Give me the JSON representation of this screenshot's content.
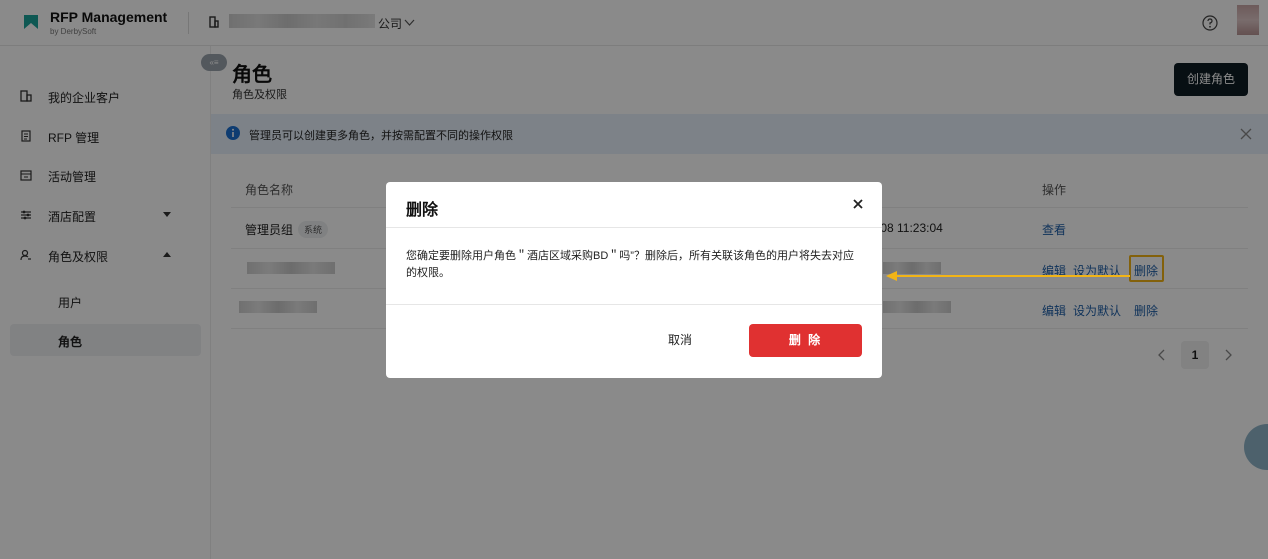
{
  "app": {
    "title": "RFP Management",
    "subtitle": "by DerbySoft"
  },
  "header": {
    "company_suffix": "公司"
  },
  "sidebar": {
    "collapse_label": "«≡",
    "items": [
      {
        "label": "我的企业客户"
      },
      {
        "label": "RFP 管理"
      },
      {
        "label": "活动管理"
      },
      {
        "label": "酒店配置"
      },
      {
        "label": "角色及权限"
      }
    ],
    "sub_items": [
      {
        "label": "用户"
      },
      {
        "label": "角色"
      }
    ]
  },
  "page": {
    "title": "角色",
    "subtitle": "角色及权限",
    "create_button": "创建角色"
  },
  "info": {
    "text": "管理员可以创建更多角色，并按需配置不同的操作权限"
  },
  "table": {
    "headers": [
      "角色名称",
      "操作"
    ],
    "rows": [
      {
        "name": "管理员组",
        "badge": "系统",
        "time": "/08 11:23:04",
        "actions": [
          "查看"
        ]
      },
      {
        "actions": [
          "编辑",
          "设为默认",
          "删除"
        ]
      },
      {
        "actions": [
          "编辑",
          "设为默认",
          "删除"
        ]
      }
    ]
  },
  "pagination": {
    "current": "1"
  },
  "modal": {
    "title": "删除",
    "body": "您确定要删除用户角色＂酒店区域采购BD＂吗”？删除后，所有关联该角色的用户将失去对应的权限。",
    "cancel": "取消",
    "confirm": "删 除"
  },
  "colors": {
    "primary_dark": "#0e1c24",
    "link": "#1f5fa8",
    "danger": "#e03131",
    "highlight": "#f2b416",
    "info_bg": "#e8f1fb"
  }
}
